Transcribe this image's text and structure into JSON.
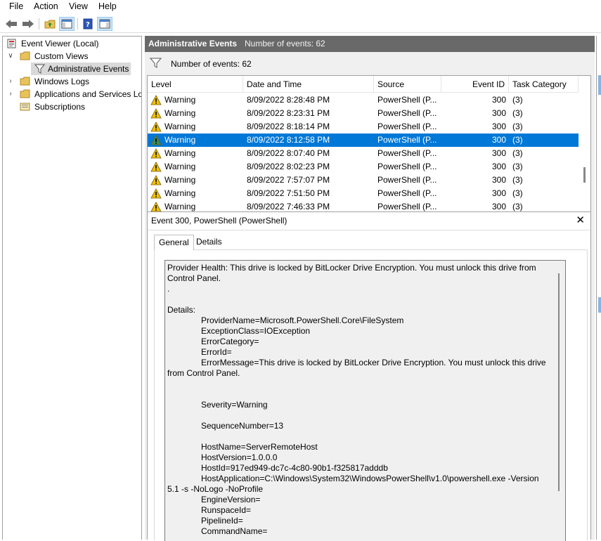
{
  "menu": [
    "File",
    "Action",
    "View",
    "Help"
  ],
  "tree": {
    "root": "Event Viewer (Local)",
    "custom_views": "Custom Views",
    "admin_events": "Administrative Events",
    "windows_logs": "Windows Logs",
    "apps_services": "Applications and Services Lo",
    "subscriptions": "Subscriptions"
  },
  "header": {
    "title": "Administrative Events",
    "count": "Number of events: 62"
  },
  "filter": {
    "count": "Number of events: 62"
  },
  "columns": [
    "Level",
    "Date and Time",
    "Source",
    "Event ID",
    "Task Category"
  ],
  "rows": [
    {
      "level": "Warning",
      "date": "8/09/2022 8:28:48 PM",
      "source": "PowerShell (P...",
      "id": "300",
      "cat": "(3)"
    },
    {
      "level": "Warning",
      "date": "8/09/2022 8:23:31 PM",
      "source": "PowerShell (P...",
      "id": "300",
      "cat": "(3)"
    },
    {
      "level": "Warning",
      "date": "8/09/2022 8:18:14 PM",
      "source": "PowerShell (P...",
      "id": "300",
      "cat": "(3)"
    },
    {
      "level": "Warning",
      "date": "8/09/2022 8:12:58 PM",
      "source": "PowerShell (P...",
      "id": "300",
      "cat": "(3)"
    },
    {
      "level": "Warning",
      "date": "8/09/2022 8:07:40 PM",
      "source": "PowerShell (P...",
      "id": "300",
      "cat": "(3)"
    },
    {
      "level": "Warning",
      "date": "8/09/2022 8:02:23 PM",
      "source": "PowerShell (P...",
      "id": "300",
      "cat": "(3)"
    },
    {
      "level": "Warning",
      "date": "8/09/2022 7:57:07 PM",
      "source": "PowerShell (P...",
      "id": "300",
      "cat": "(3)"
    },
    {
      "level": "Warning",
      "date": "8/09/2022 7:51:50 PM",
      "source": "PowerShell (P...",
      "id": "300",
      "cat": "(3)"
    },
    {
      "level": "Warning",
      "date": "8/09/2022 7:46:33 PM",
      "source": "PowerShell (P...",
      "id": "300",
      "cat": "(3)"
    }
  ],
  "selected_row": 3,
  "detail": {
    "title": "Event 300, PowerShell (PowerShell)",
    "tabs": [
      "General",
      "Details"
    ],
    "message": "Provider Health: This drive is locked by BitLocker Drive Encryption. You must unlock this drive from Control Panel.\n.\n\nDetails:\n\tProviderName=Microsoft.PowerShell.Core\\FileSystem\n\tExceptionClass=IOException\n\tErrorCategory=\n\tErrorId=\n\tErrorMessage=This drive is locked by BitLocker Drive Encryption. You must unlock this drive from Control Panel.\n\n\n\tSeverity=Warning\n\n\tSequenceNumber=13\n\n\tHostName=ServerRemoteHost\n\tHostVersion=1.0.0.0\n\tHostId=917ed949-dc7c-4c80-90b1-f325817adddb\n\tHostApplication=C:\\Windows\\System32\\WindowsPowerShell\\v1.0\\powershell.exe -Version 5.1 -s -NoLogo -NoProfile\n\tEngineVersion=\n\tRunspaceId=\n\tPipelineId=\n\tCommandName="
  },
  "colors": {
    "selection": "#0078d7",
    "header_bg": "#696969",
    "warning": "#f2c200"
  }
}
